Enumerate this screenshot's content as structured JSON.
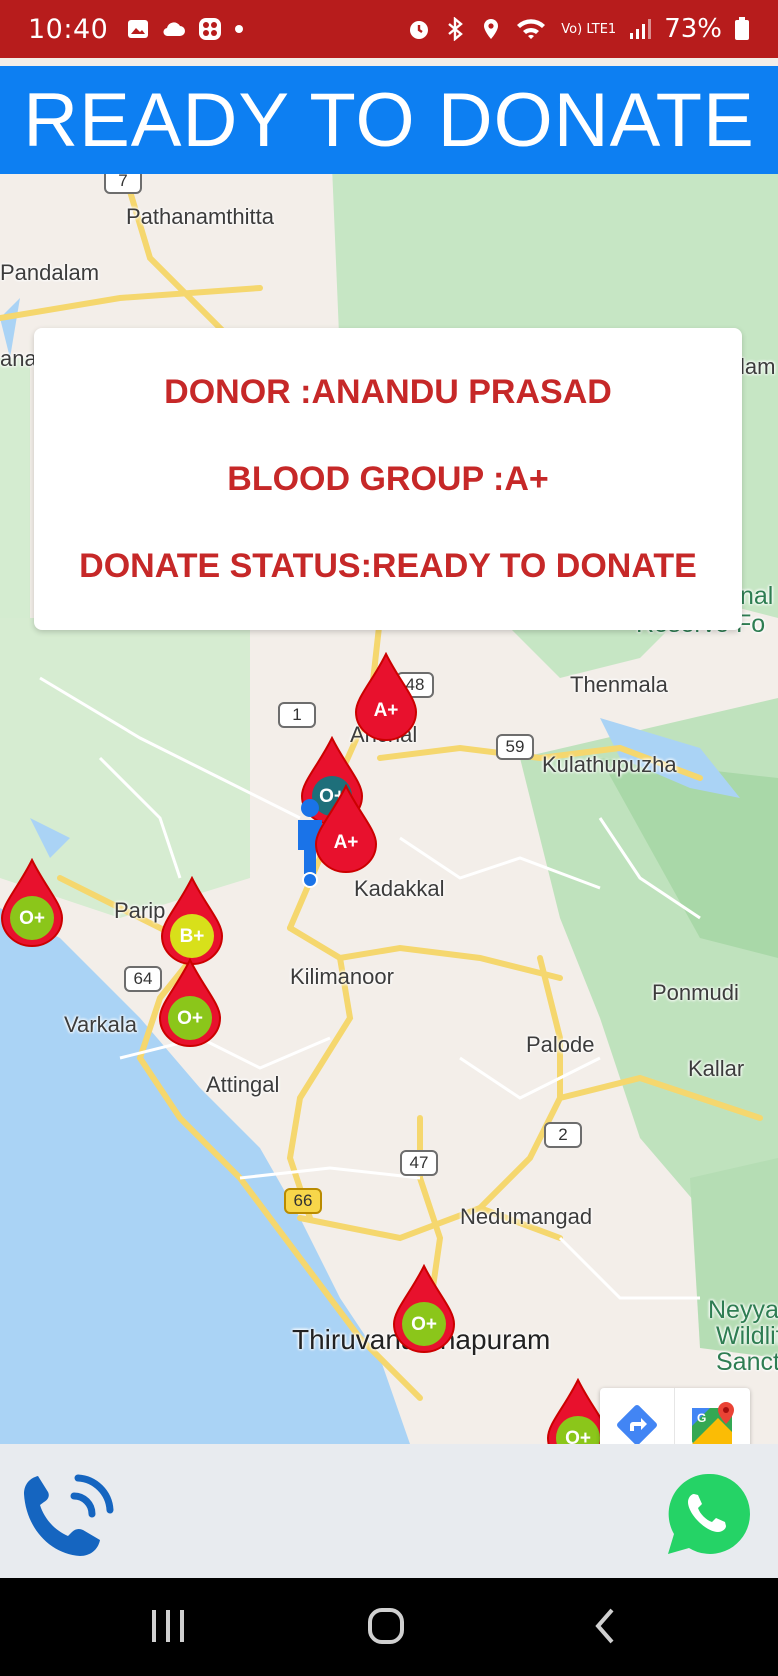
{
  "status_bar": {
    "time": "10:40",
    "battery": "73%",
    "network": "Vo) LTE1",
    "icons": [
      "gallery-icon",
      "cloud-icon",
      "app-icon",
      "dot-icon",
      "alarm-icon",
      "bluetooth-icon",
      "location-icon",
      "wifi-icon",
      "signal-icon",
      "battery-icon"
    ]
  },
  "header": {
    "title": "READY TO DONATE",
    "color": "#0d7ff2"
  },
  "donor_card": {
    "donor_line": "DONOR :ANANDU PRASAD",
    "blood_group_line": "BLOOD GROUP :A+",
    "status_line": "DONATE STATUS:READY TO DONATE",
    "text_color": "#c62828"
  },
  "map": {
    "places": {
      "pathanamthitta": "Pathanamthitta",
      "pandalam": "Pandalam",
      "ana": "ana",
      "lam": "lam",
      "nal": "nal",
      "reserve": "Reserve Fo",
      "thenmala": "Thenmala",
      "kulathupuzha": "Kulathupuzha",
      "anchal": "Anchal",
      "kadakkal": "Kadakkal",
      "paripally": "Parip",
      "kilimanoor": "Kilimanoor",
      "varkala": "Varkala",
      "attingal": "Attingal",
      "palode": "Palode",
      "ponmudi": "Ponmudi",
      "kallar": "Kallar",
      "nedumangad": "Nedumangad",
      "thiruvananthapuram": "Thiruvananthapuram",
      "neyyar": "Neyya",
      "wildlife": "Wildlif",
      "sanctuary": "Sanctua"
    },
    "shields": [
      "7",
      "1",
      "48",
      "59",
      "64",
      "2",
      "47",
      "66"
    ],
    "markers": [
      {
        "group": "A+",
        "kind": "red"
      },
      {
        "group": "O+",
        "kind": "dark"
      },
      {
        "group": "A+",
        "kind": "red"
      },
      {
        "group": "O+",
        "kind": "green"
      },
      {
        "group": "B+",
        "kind": "yellow"
      },
      {
        "group": "O+",
        "kind": "green"
      },
      {
        "group": "O+",
        "kind": "green"
      },
      {
        "group": "O+",
        "kind": "green"
      }
    ],
    "google_logo": "Google"
  },
  "actions": {
    "call": "phone-call-icon",
    "whatsapp": "whatsapp-icon"
  },
  "nav": [
    "recents-icon",
    "home-icon",
    "back-icon"
  ]
}
